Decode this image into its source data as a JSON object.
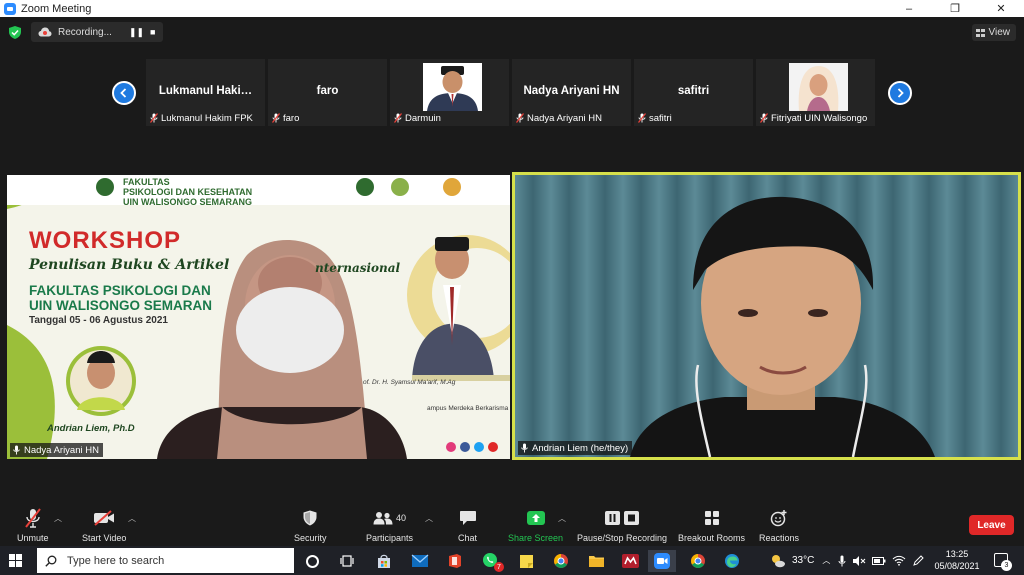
{
  "window": {
    "title": "Zoom Meeting",
    "minimize": "–",
    "maximize": "❐",
    "close": "✕"
  },
  "recording": {
    "label": "Recording...",
    "pause": "❚❚",
    "stop": "■"
  },
  "view": {
    "label": "View"
  },
  "thumbnails": [
    {
      "display_name": "Lukmanul  Haki…",
      "label": "Lukmanul Hakim FPK",
      "muted": true
    },
    {
      "display_name": "faro",
      "label": "faro",
      "muted": true
    },
    {
      "display_name": "",
      "label": "Darmuin",
      "muted": true
    },
    {
      "display_name": "Nadya Ariyani HN",
      "label": "Nadya Ariyani HN",
      "muted": true
    },
    {
      "display_name": "safitri",
      "label": "safitri",
      "muted": true
    },
    {
      "display_name": "",
      "label": "Fitriyati UIN Walisongo",
      "muted": true
    }
  ],
  "tiles": {
    "left_label": "Nadya Ariyani HN",
    "right_label": "Andrian Liem (he/they)"
  },
  "poster": {
    "faculty_header": "FAKULTAS\nPSIKOLOGI DAN KESEHATAN\nUIN WALISONGO SEMARANG",
    "workshop": "WORKSHOP",
    "subtitle": "Penulisan Buku & Artikel",
    "subtitle_end": "nternasional",
    "faculty_line1": "FAKULTAS PSIKOLOGI DAN",
    "faculty_line2": "UIN WALISONGO SEMARAN",
    "date": "Tanggal 05 - 06 Agustus 2021",
    "speaker": "Andrian Liem, Ph.D",
    "prof": "of. Dr. H. Syamsul Ma'arif, M.Ag",
    "merdeka": "ampus Merdeka Berkarisma"
  },
  "toolbar": {
    "unmute": "Unmute",
    "start_video": "Start Video",
    "security": "Security",
    "participants": "Participants",
    "participants_count": "40",
    "chat": "Chat",
    "share_screen": "Share Screen",
    "pause_stop_recording": "Pause/Stop Recording",
    "breakout_rooms": "Breakout Rooms",
    "reactions": "Reactions",
    "leave": "Leave"
  },
  "taskbar": {
    "search_placeholder": "Type here to search",
    "weather": "33°C",
    "time": "13:25",
    "date": "05/08/2021",
    "notification_count": "3",
    "whatsapp_badge": "7"
  },
  "colors": {
    "zoom_blue": "#2d8cff",
    "active_speaker": "#d6e04b",
    "leave_red": "#e02828",
    "share_green": "#23c552",
    "muted_red": "#e8413a"
  }
}
